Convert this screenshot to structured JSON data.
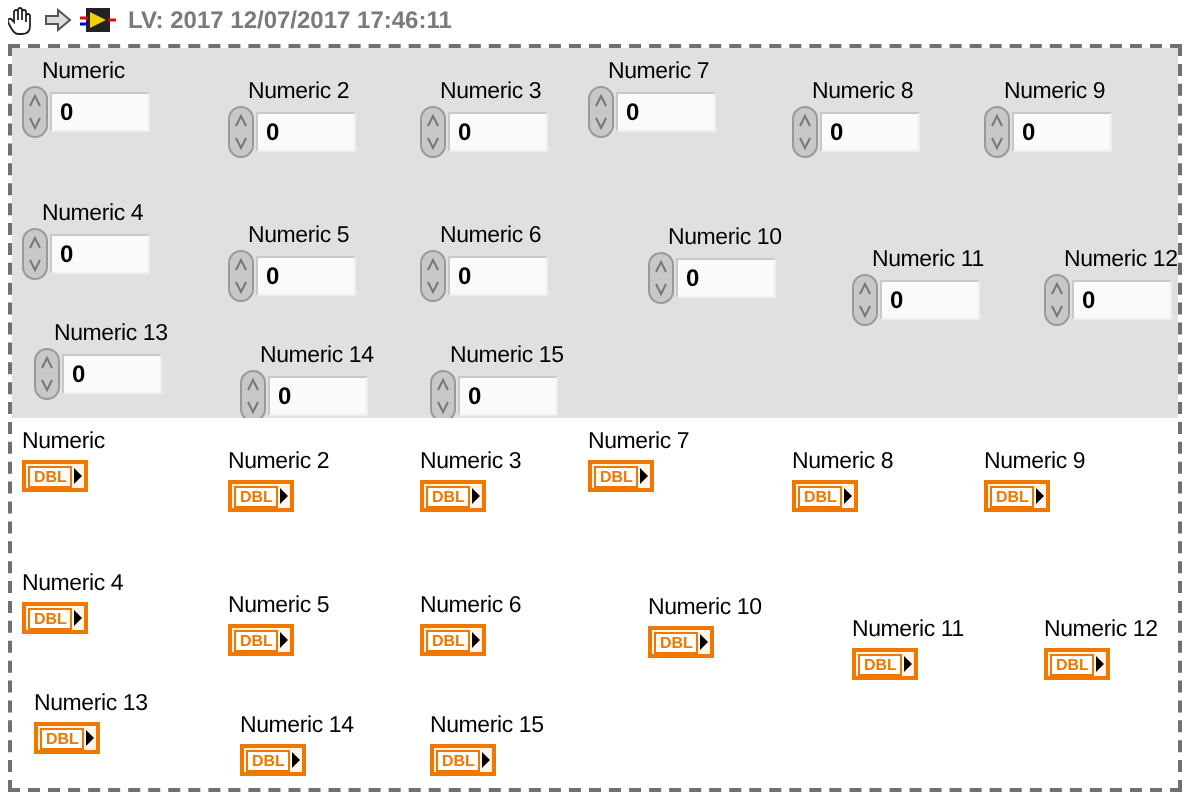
{
  "title": "LV: 2017 12/07/2017 17:46:11",
  "controls": [
    {
      "label": "Numeric",
      "value": "0"
    },
    {
      "label": "Numeric 2",
      "value": "0"
    },
    {
      "label": "Numeric 3",
      "value": "0"
    },
    {
      "label": "Numeric 7",
      "value": "0"
    },
    {
      "label": "Numeric 8",
      "value": "0"
    },
    {
      "label": "Numeric 9",
      "value": "0"
    },
    {
      "label": "Numeric 4",
      "value": "0"
    },
    {
      "label": "Numeric 5",
      "value": "0"
    },
    {
      "label": "Numeric 6",
      "value": "0"
    },
    {
      "label": "Numeric 10",
      "value": "0"
    },
    {
      "label": "Numeric 11",
      "value": "0"
    },
    {
      "label": "Numeric 12",
      "value": "0"
    },
    {
      "label": "Numeric 13",
      "value": "0"
    },
    {
      "label": "Numeric 14",
      "value": "0"
    },
    {
      "label": "Numeric 15",
      "value": "0"
    }
  ],
  "terminals": [
    {
      "label": "Numeric",
      "type": "DBL"
    },
    {
      "label": "Numeric 2",
      "type": "DBL"
    },
    {
      "label": "Numeric 3",
      "type": "DBL"
    },
    {
      "label": "Numeric 7",
      "type": "DBL"
    },
    {
      "label": "Numeric 8",
      "type": "DBL"
    },
    {
      "label": "Numeric 9",
      "type": "DBL"
    },
    {
      "label": "Numeric 4",
      "type": "DBL"
    },
    {
      "label": "Numeric 5",
      "type": "DBL"
    },
    {
      "label": "Numeric 6",
      "type": "DBL"
    },
    {
      "label": "Numeric 10",
      "type": "DBL"
    },
    {
      "label": "Numeric 11",
      "type": "DBL"
    },
    {
      "label": "Numeric 12",
      "type": "DBL"
    },
    {
      "label": "Numeric 13",
      "type": "DBL"
    },
    {
      "label": "Numeric 14",
      "type": "DBL"
    },
    {
      "label": "Numeric 15",
      "type": "DBL"
    }
  ]
}
